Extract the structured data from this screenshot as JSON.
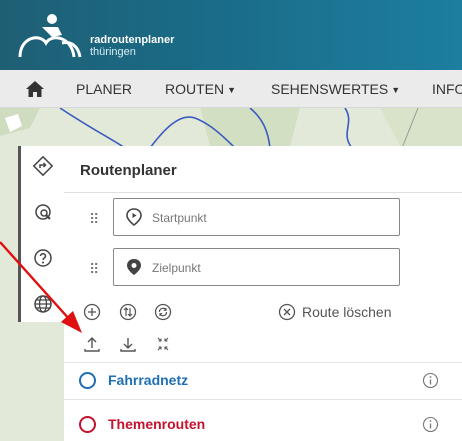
{
  "brand": {
    "name_line1": "radroutenplaner",
    "name_line2": "thüringen"
  },
  "navbar": {
    "home_icon": "home-icon",
    "items": [
      {
        "label": "PLANER",
        "dropdown": false
      },
      {
        "label": "ROUTEN",
        "dropdown": true
      },
      {
        "label": "SEHENSWERTES",
        "dropdown": true
      },
      {
        "label": "INFO",
        "dropdown": false
      }
    ]
  },
  "sidebar": {
    "buttons": [
      {
        "icon": "route-planner-icon",
        "active": true
      },
      {
        "icon": "route-search-icon",
        "active": false
      },
      {
        "icon": "help-icon",
        "active": false
      },
      {
        "icon": "globe-icon",
        "active": false
      }
    ]
  },
  "panel": {
    "title": "Routenplaner",
    "start_placeholder": "Startpunkt",
    "end_placeholder": "Zielpunkt",
    "tools_row1": [
      "add-waypoint-icon",
      "reverse-route-icon",
      "roundtrip-icon"
    ],
    "clear_route_label": "Route löschen",
    "tools_row2": [
      "upload-icon",
      "download-icon",
      "collapse-icon"
    ],
    "layers": [
      {
        "label": "Fahrradnetz",
        "color": "#1f6fb5"
      },
      {
        "label": "Themenrouten",
        "color": "#c4122f"
      }
    ]
  },
  "colors": {
    "header": "#1a6a86",
    "accent_blue": "#1f6fb5",
    "accent_red": "#c4122f",
    "annotation_arrow": "#e01010"
  }
}
